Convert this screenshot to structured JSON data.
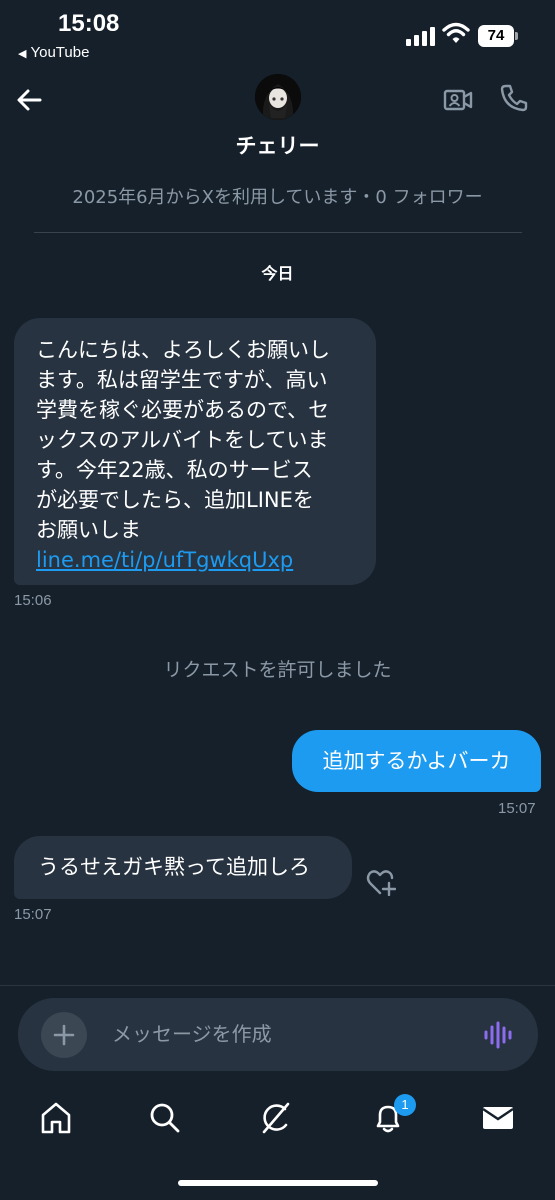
{
  "status": {
    "time": "15:08",
    "back_app": "YouTube",
    "battery": "74"
  },
  "header": {
    "name": "チェリー"
  },
  "profile_info": "2025年6月からXを利用しています・0 フォロワー",
  "date_label": "今日",
  "messages": [
    {
      "direction": "incoming",
      "lines": [
        "こんにちは、よろしくお願いし",
        "ます。私は留学生ですが、高い",
        "学費を稼ぐ必要があるので、セ",
        "ックスのアルバイトをしていま",
        "す。今年22歳、私のサービス",
        "が必要でしたら、追加LINEを",
        "お願いしま"
      ],
      "link": "line.me/ti/p/ufTgwkqUxp",
      "time": "15:06"
    },
    {
      "direction": "system",
      "text": "リクエストを許可しました"
    },
    {
      "direction": "outgoing",
      "text": "追加するかよバーカ",
      "time": "15:07"
    },
    {
      "direction": "incoming",
      "text": "うるせえガキ黙って追加しろ",
      "time": "15:07"
    }
  ],
  "compose": {
    "placeholder": "メッセージを作成"
  },
  "tabbar": {
    "items": [
      "home-icon",
      "search-icon",
      "grok-icon",
      "notifications-icon",
      "messages-icon"
    ],
    "notification_badge": "1"
  },
  "colors": {
    "background": "#15202b",
    "bubble_incoming": "#273340",
    "bubble_outgoing": "#1d9bf0",
    "muted_text": "#8b98a5",
    "voice_icon": "#8e6cf0"
  }
}
